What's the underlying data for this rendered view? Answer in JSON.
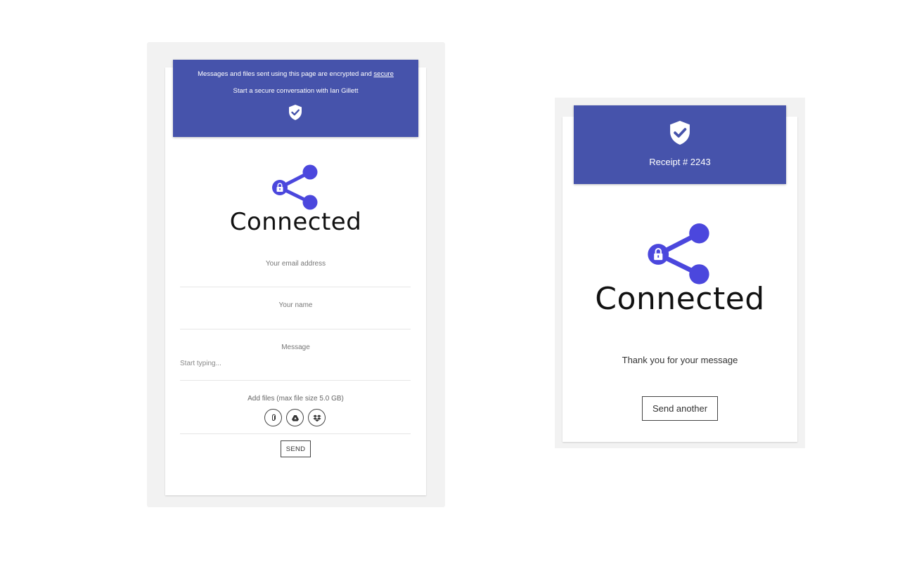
{
  "colors": {
    "banner": "#4653ab",
    "accent": "#4b47dd",
    "panel_bg": "#f2f2f2"
  },
  "form_card": {
    "banner": {
      "notice_prefix": "Messages and files sent using this page are encrypted and",
      "notice_link": "secure",
      "subtitle": "Start a secure conversation with Ian Gillett",
      "icon": "shield-check-icon"
    },
    "logo": {
      "icon": "share-lock-icon",
      "wordmark": "Connected"
    },
    "fields": {
      "email_label": "Your email address",
      "name_label": "Your name",
      "message_label": "Message",
      "message_placeholder": "Start typing..."
    },
    "attachments": {
      "label": "Add files (max file size 5.0 GB)",
      "buttons": [
        "paperclip-icon",
        "google-drive-icon",
        "dropbox-icon"
      ]
    },
    "send_label": "SEND"
  },
  "receipt_card": {
    "banner": {
      "icon": "shield-check-icon",
      "receipt": "Receipt # 2243"
    },
    "logo": {
      "icon": "share-lock-icon",
      "wordmark": "Connected"
    },
    "thank_you": "Thank you for your message",
    "send_another_label": "Send another"
  }
}
